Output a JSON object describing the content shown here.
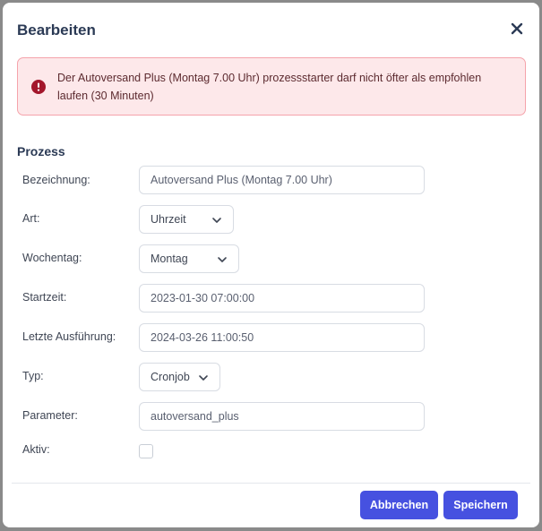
{
  "dialog": {
    "title": "Bearbeiten"
  },
  "alert": {
    "message": "Der Autoversand Plus (Montag 7.00 Uhr) prozessstarter darf nicht öfter als empfohlen laufen (30 Minuten)",
    "color": "#fde8ea",
    "icon_color": "#a3162b"
  },
  "section": {
    "title": "Prozess"
  },
  "form": {
    "bezeichnung_label": "Bezeichnung:",
    "bezeichnung_value": "Autoversand Plus (Montag 7.00 Uhr)",
    "art_label": "Art:",
    "art_value": "Uhrzeit",
    "wochentag_label": "Wochentag:",
    "wochentag_value": "Montag",
    "startzeit_label": "Startzeit:",
    "startzeit_value": "2023-01-30 07:00:00",
    "letzte_label": "Letzte Ausführung:",
    "letzte_value": "2024-03-26 11:00:50",
    "typ_label": "Typ:",
    "typ_value": "Cronjob",
    "parameter_label": "Parameter:",
    "parameter_value": "autoversand_plus",
    "aktiv_label": "Aktiv:",
    "aktiv_checked": false
  },
  "footer": {
    "cancel_label": "Abbrechen",
    "save_label": "Speichern",
    "button_color": "#4651e0"
  },
  "icons": {
    "close": "close-icon",
    "alert": "exclamation-circle-icon",
    "chevron": "chevron-down-icon"
  }
}
